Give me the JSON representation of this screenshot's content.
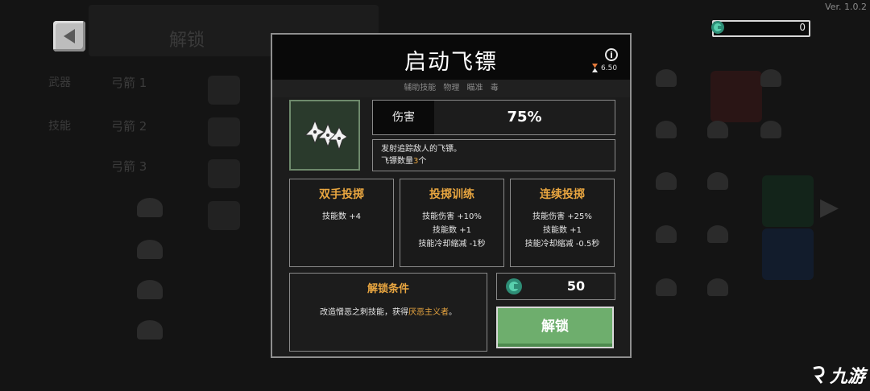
{
  "version": "Ver. 1.0.2",
  "currency": {
    "value": "0",
    "icon": "gem-icon",
    "color": "#3fb89a"
  },
  "skill": {
    "title": "启动飞镖",
    "cooldown": "6.50",
    "tags": [
      "辅助技能",
      "物理",
      "瞄准",
      "毒"
    ],
    "damage_label": "伤害",
    "damage_value": "75%",
    "description_line1": "发射追踪敌人的飞镖。",
    "description_line2_prefix": "飞镖数量",
    "description_line2_highlight": "3",
    "description_line2_suffix": "个"
  },
  "upgrades": [
    {
      "title": "双手投掷",
      "lines": [
        "技能数 +4"
      ]
    },
    {
      "title": "投掷训练",
      "lines": [
        "技能伤害 +10%",
        "技能数 +1",
        "技能冷却缩减 -1秒"
      ]
    },
    {
      "title": "连续投掷",
      "lines": [
        "技能伤害 +25%",
        "技能数 +1",
        "技能冷却缩减 -0.5秒"
      ]
    }
  ],
  "unlock_condition": {
    "title": "解锁条件",
    "text_prefix": "改造憎恶之刺技能，获得",
    "text_highlight": "厌恶主义者",
    "text_suffix": "。"
  },
  "cost": {
    "value": "50"
  },
  "unlock_button": {
    "label": "解锁"
  },
  "background": {
    "banner_text": "解锁",
    "list_labels": [
      "弓箭 1",
      "弓箭 2",
      "弓箭 3"
    ],
    "side_tabs": [
      "武器",
      "技能"
    ]
  },
  "watermark": {
    "text": "九游"
  },
  "colors": {
    "accent": "#e9a640",
    "button_green": "#6eae6d",
    "panel_bg": "#1c1c1c"
  }
}
